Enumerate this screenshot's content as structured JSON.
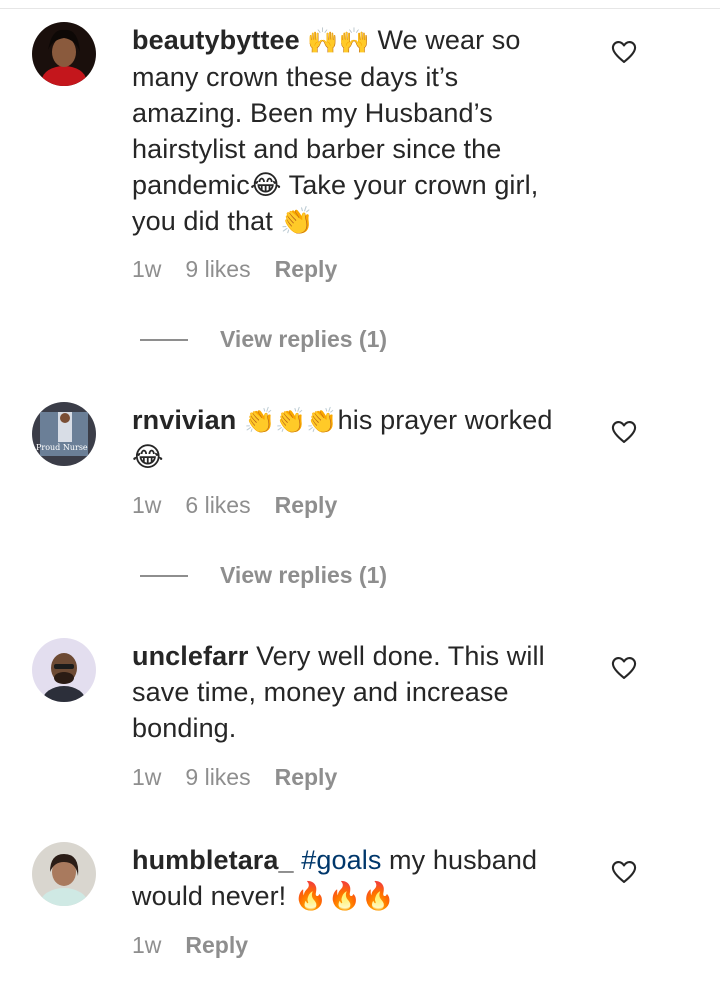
{
  "comments": [
    {
      "username": "beautybyttee",
      "emoji_lead": "🙌🙌",
      "text": "We wear so many crown these days it’s amazing. Been my Husband’s hairstylist and barber since the pandemic😂 Take your crown girl, you did that 👏",
      "time": "1w",
      "likes": "9 likes",
      "reply": "Reply",
      "view_replies": "View replies (1)"
    },
    {
      "username": "rnvivian",
      "emoji_lead": "👏👏👏",
      "text": "his prayer worked 😂",
      "time": "1w",
      "likes": "6 likes",
      "reply": "Reply",
      "view_replies": "View replies (1)"
    },
    {
      "username": "unclefarr",
      "text": "Very well done. This will save time, money and increase bonding.",
      "time": "1w",
      "likes": "9 likes",
      "reply": "Reply"
    },
    {
      "username": "humbletara_",
      "hashtag": "#goals",
      "text": "my husband would never! 🔥🔥🔥",
      "time": "1w",
      "reply": "Reply"
    }
  ],
  "avatar_text_rnvivian": "Proud Nurse",
  "icons": {
    "like": "heart-outline-icon"
  },
  "colors": {
    "text": "#262626",
    "muted": "#8e8e8e",
    "hashtag": "#00376b"
  }
}
